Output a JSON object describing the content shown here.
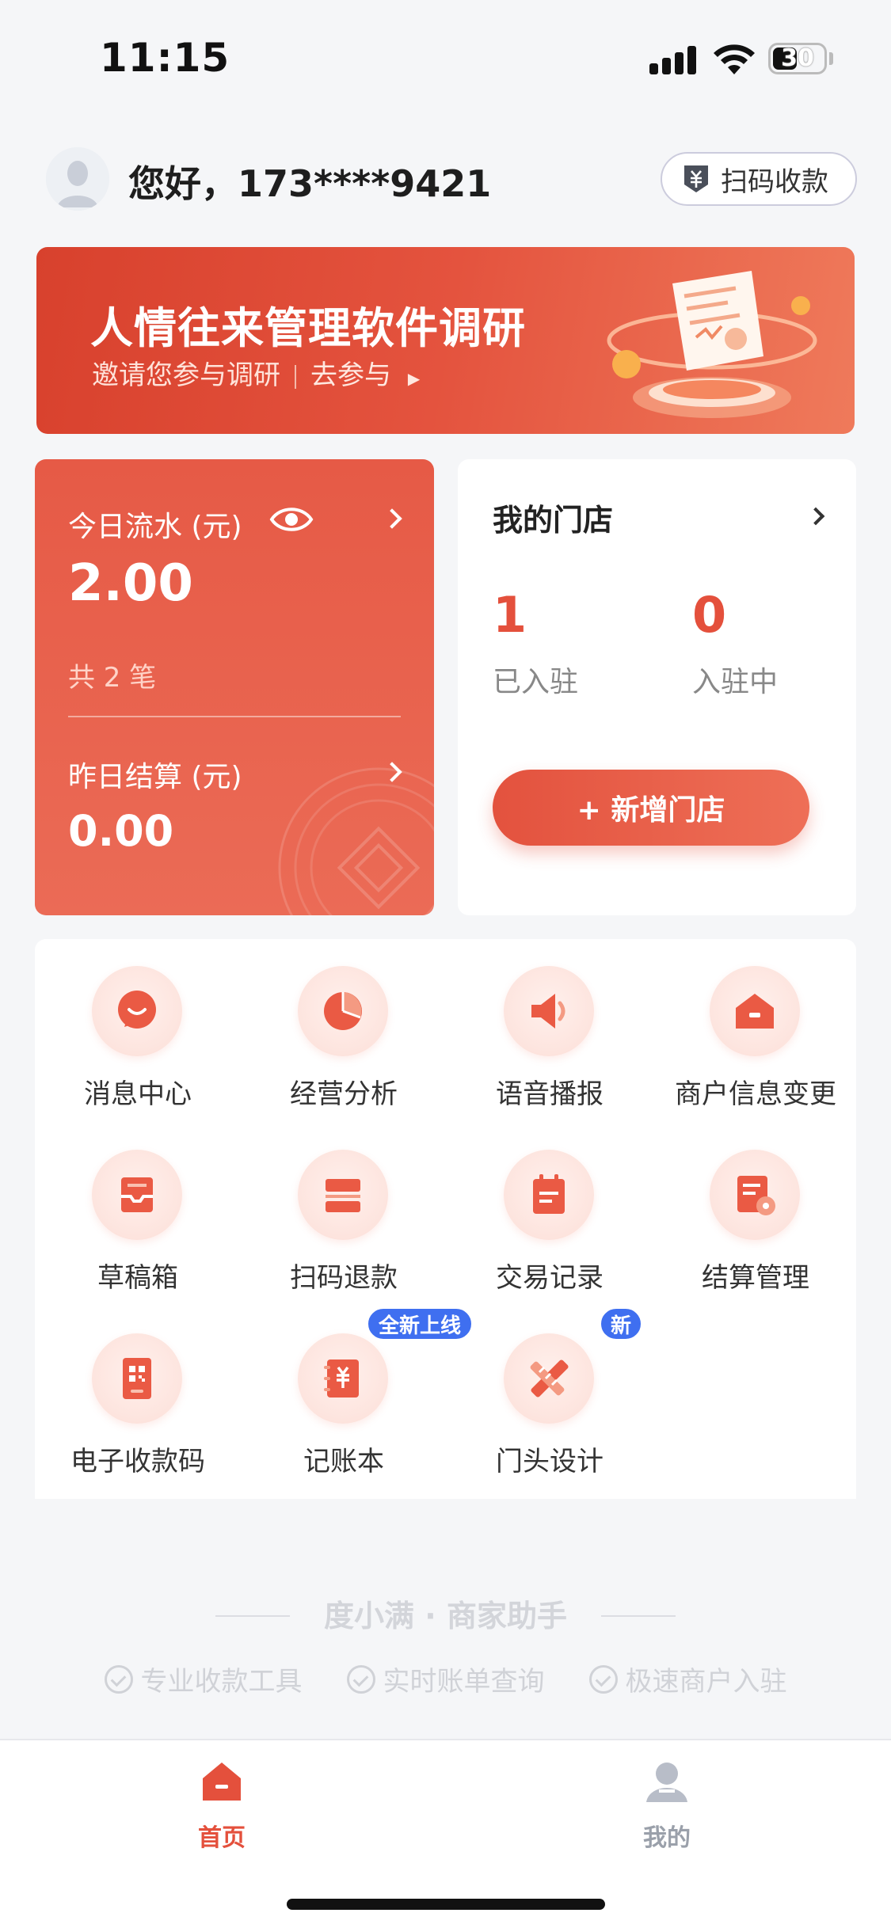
{
  "status_bar": {
    "time": "11:15",
    "battery": "30"
  },
  "header": {
    "greeting": "您好，173****9421",
    "scan_pay_label": "扫码收款"
  },
  "banner": {
    "title": "人情往来管理软件调研",
    "subtitle": "邀请您参与调研",
    "cta": "去参与"
  },
  "flow_card": {
    "today_label": "今日流水 (元)",
    "today_amount": "2.00",
    "count_label": "共 2 笔",
    "yesterday_label": "昨日结算 (元)",
    "yesterday_amount": "0.00"
  },
  "store_card": {
    "title": "我的门店",
    "settled_count": "1",
    "settled_label": "已入驻",
    "settling_count": "0",
    "settling_label": "入驻中",
    "add_button": "+ 新增门店"
  },
  "grid": {
    "items": [
      {
        "label": "消息中心",
        "icon": "message-icon"
      },
      {
        "label": "经营分析",
        "icon": "pie-chart-icon"
      },
      {
        "label": "语音播报",
        "icon": "speaker-icon"
      },
      {
        "label": "商户信息变更",
        "icon": "shop-icon"
      },
      {
        "label": "草稿箱",
        "icon": "inbox-icon"
      },
      {
        "label": "扫码退款",
        "icon": "card-icon"
      },
      {
        "label": "交易记录",
        "icon": "calendar-icon"
      },
      {
        "label": "结算管理",
        "icon": "settlement-doc-icon"
      },
      {
        "label": "电子收款码",
        "icon": "qr-code-icon"
      },
      {
        "label": "记账本",
        "icon": "ledger-icon",
        "badge": "全新上线"
      },
      {
        "label": "门头设计",
        "icon": "design-tools-icon",
        "badge": "新"
      }
    ]
  },
  "footer": {
    "brand": "度小满 · 商家助手",
    "features": [
      "专业收款工具",
      "实时账单查询",
      "极速商户入驻"
    ]
  },
  "tabbar": {
    "tabs": [
      {
        "label": "首页",
        "active": true
      },
      {
        "label": "我的",
        "active": false
      }
    ]
  },
  "colors": {
    "accent": "#e4503c",
    "badge": "#3f6ff0",
    "inactive": "#9aa0aa"
  }
}
